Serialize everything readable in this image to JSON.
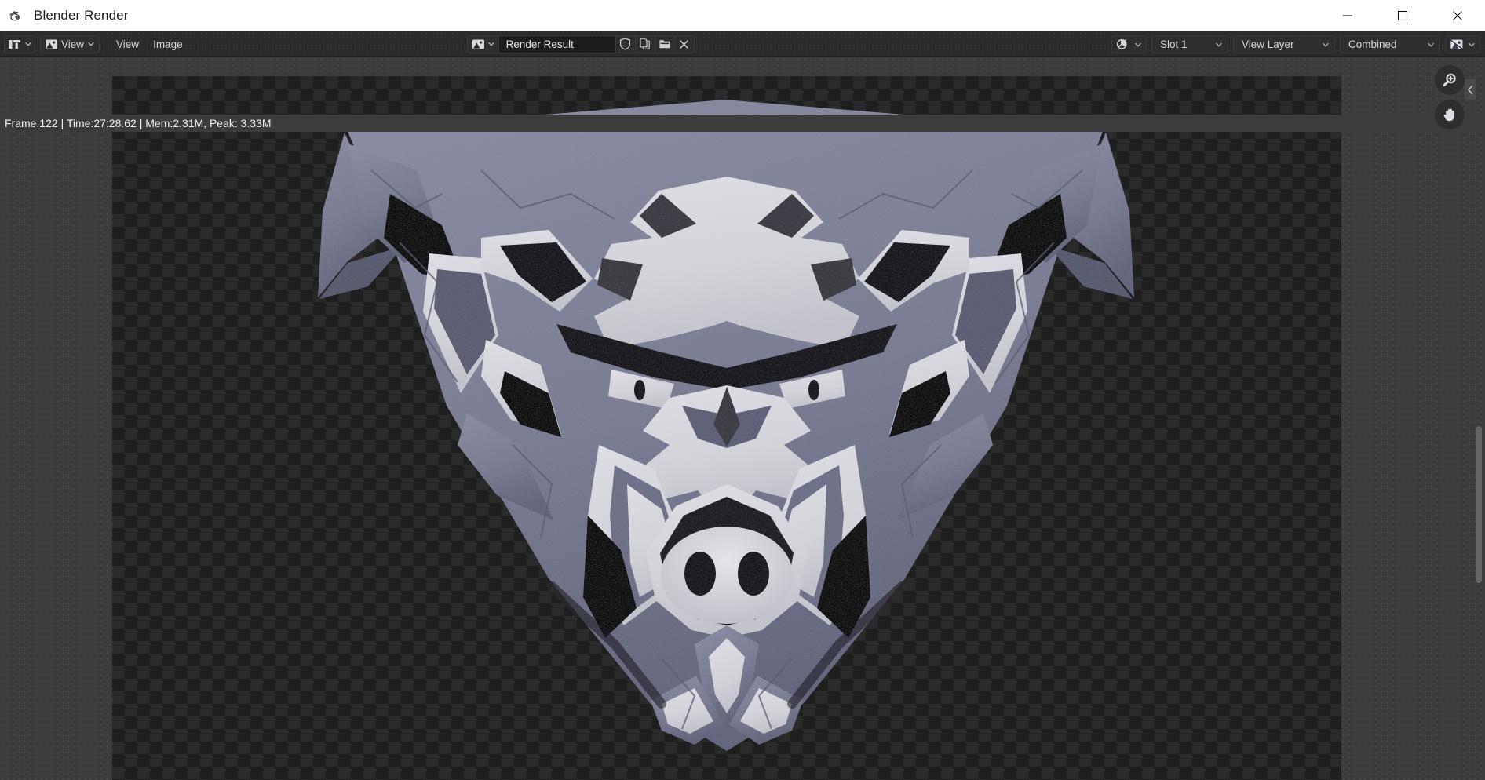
{
  "window": {
    "title": "Blender Render",
    "logo_icon": "blender-logo-icon",
    "controls": {
      "minimize_label": "Minimize",
      "maximize_label": "Maximize",
      "close_label": "Close"
    }
  },
  "header": {
    "editor_type": {
      "icon": "image-editor-icon",
      "label": ""
    },
    "view_mode": {
      "icon": "image-view-mode-icon",
      "label": "View"
    },
    "menus": [
      {
        "label": "View",
        "name": "menu-view"
      },
      {
        "label": "Image",
        "name": "menu-image"
      }
    ],
    "id_block": {
      "type_icon": "image-datablock-icon",
      "name_value": "Render Result",
      "name_placeholder": "Render Result",
      "buttons": [
        {
          "icon": "shield-fake-user-icon",
          "name": "fake-user-button"
        },
        {
          "icon": "duplicate-icon",
          "name": "duplicate-button"
        },
        {
          "icon": "folder-open-icon",
          "name": "open-image-button"
        },
        {
          "icon": "unlink-x-icon",
          "name": "unlink-button"
        }
      ]
    },
    "right": {
      "display_channel_icon": "render-display-mode-icon",
      "slot": {
        "label": "Slot 1",
        "name": "slot-dropdown"
      },
      "view_layer": {
        "label": "View Layer",
        "name": "view-layer-dropdown"
      },
      "pass": {
        "label": "Combined",
        "name": "pass-dropdown"
      },
      "display_mode_icon": "display-channels-icon"
    }
  },
  "status": {
    "text": "Frame:122 | Time:27:28.62 | Mem:2.31M, Peak: 3.33M",
    "frame": "122",
    "time": "27:28.62",
    "mem": "2.31M",
    "peak": "3.33M"
  },
  "canvas": {
    "alt": "Rendered boar mascot emblem on transparent checkerboard background",
    "colors": {
      "light": "#d3d4da",
      "stone": "#7d7f96",
      "stone_dark": "#6a6c82",
      "dark": "#3a3a40",
      "black": "#0b0b0d",
      "checker_a": "#1f1f1f",
      "checker_b": "#2a2a2a"
    }
  },
  "gizmos": [
    {
      "icon": "zoom-in-icon",
      "name": "zoom-gizmo"
    },
    {
      "icon": "pan-hand-icon",
      "name": "pan-gizmo"
    }
  ],
  "sidebar_toggle": {
    "icon": "chevron-left-icon",
    "name": "sidebar-toggle"
  }
}
